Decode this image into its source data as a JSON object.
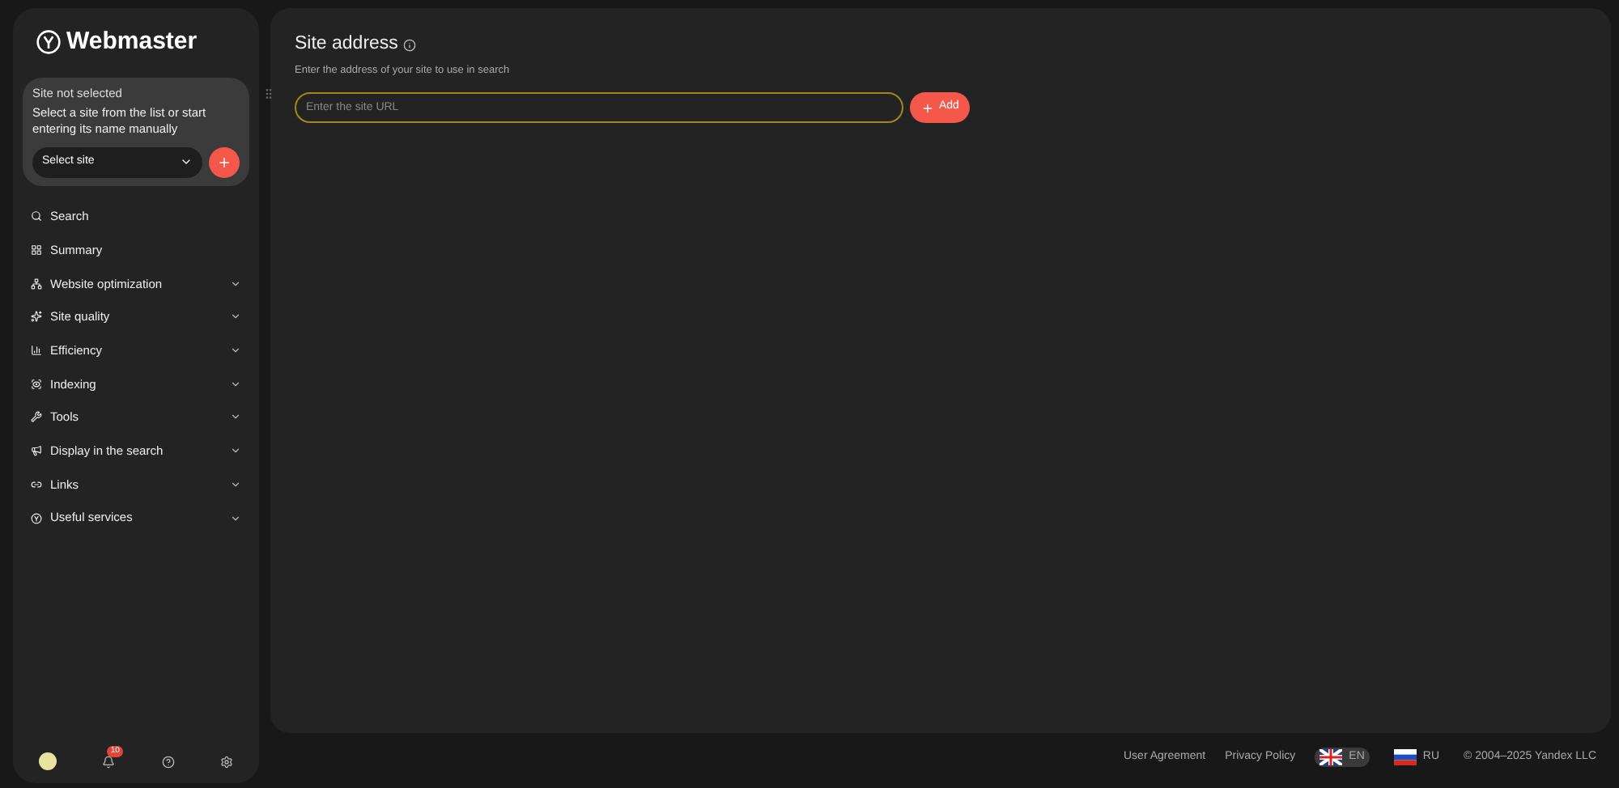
{
  "sidebar": {
    "logo": "Webmaster",
    "site_card": {
      "title": "Site not selected",
      "hint": "Select a site from the list or start entering its name manually",
      "select": {
        "value": "Select site"
      }
    },
    "nav": [
      {
        "label": "Search",
        "expandable": false
      },
      {
        "label": "Summary",
        "expandable": false
      },
      {
        "label": "Website optimization",
        "expandable": true
      },
      {
        "label": "Site quality",
        "expandable": true
      },
      {
        "label": "Efficiency",
        "expandable": true
      },
      {
        "label": "Indexing",
        "expandable": true
      },
      {
        "label": "Tools",
        "expandable": true
      },
      {
        "label": "Display in the search",
        "expandable": true
      },
      {
        "label": "Links",
        "expandable": true
      },
      {
        "label": "Useful services",
        "expandable": true
      }
    ],
    "bottom": {
      "notifications_badge": "10"
    }
  },
  "main": {
    "title": "Site address",
    "subtitle": "Enter the address of your site to use in search",
    "url_field": {
      "placeholder": "Enter the site URL"
    },
    "add_button": "Add"
  },
  "footer": {
    "links": [
      "User Agreement",
      "Privacy Policy"
    ],
    "languages": [
      {
        "code": "EN",
        "selected": true
      },
      {
        "code": "RU",
        "selected": false
      }
    ],
    "copyright": "© 2004–2025 Yandex LLC"
  }
}
